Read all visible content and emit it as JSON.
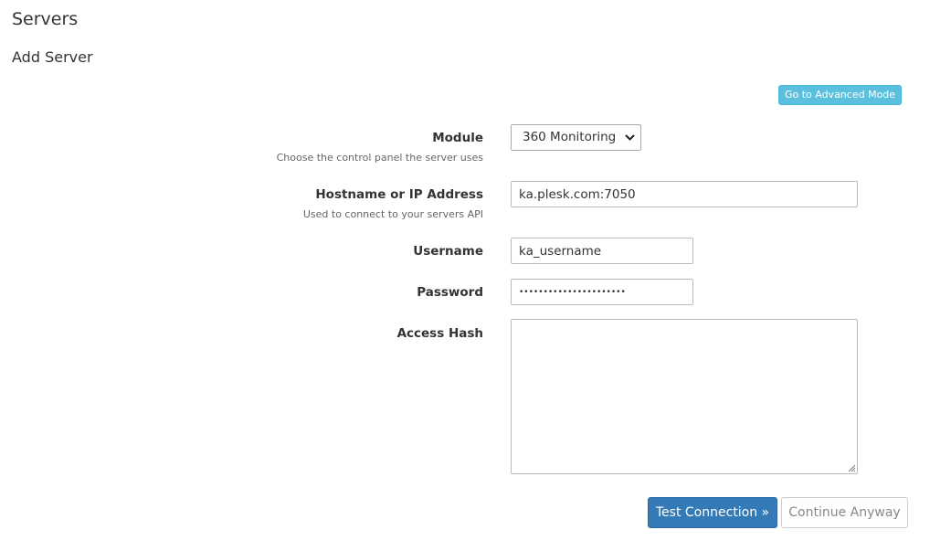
{
  "header": {
    "title": "Servers",
    "subtitle": "Add Server"
  },
  "toolbar": {
    "advanced_mode_label": "Go to Advanced Mode"
  },
  "form": {
    "module": {
      "label": "Module",
      "help": "Choose the control panel the server uses",
      "selected": "360 Monitoring"
    },
    "hostname": {
      "label": "Hostname or IP Address",
      "help": "Used to connect to your servers API",
      "value": "ka.plesk.com:7050"
    },
    "username": {
      "label": "Username",
      "value": "ka_username"
    },
    "password": {
      "label": "Password",
      "value": "••••••••••••••••••••••"
    },
    "access_hash": {
      "label": "Access Hash",
      "value": ""
    }
  },
  "actions": {
    "test_connection_label": "Test Connection »",
    "continue_anyway_label": "Continue Anyway"
  },
  "colors": {
    "info_button": "#5bc0de",
    "primary_button": "#337ab7"
  }
}
